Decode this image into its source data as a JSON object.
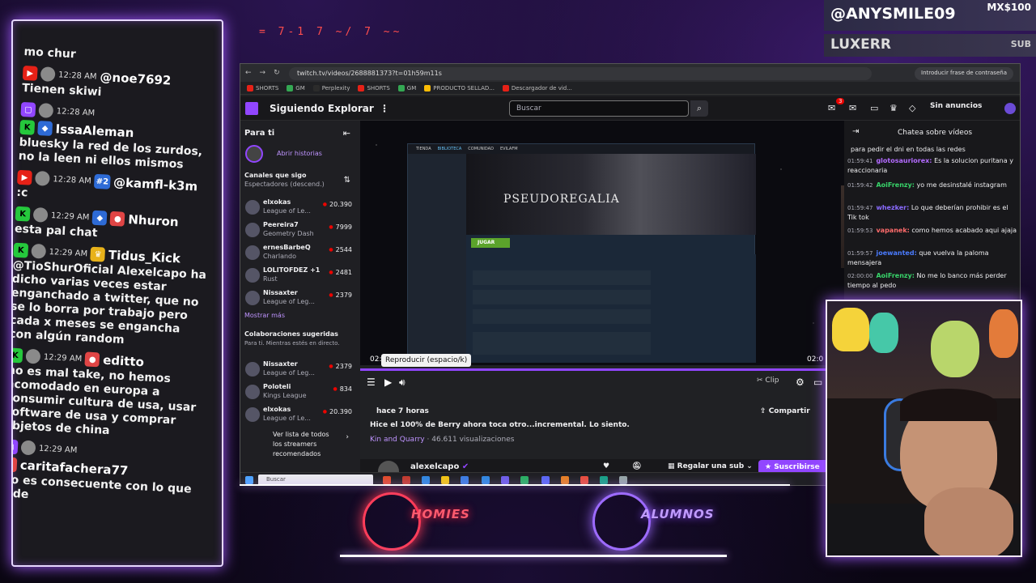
{
  "overlay": {
    "handwriting": "= 7-1 7 ~/ 7 ~~",
    "alert_top": {
      "name": "@ANYSMILE09",
      "amount": "MX$100"
    },
    "alert_sub": {
      "name": "LUXERR",
      "tag": "SUB"
    },
    "logos": [
      {
        "name": "HOMIES",
        "color": "#ff3d5a"
      },
      {
        "name": "ALUMNOS",
        "color": "#9d6bff"
      }
    ]
  },
  "stream_chat": {
    "messages": [
      {
        "platform": "youtube",
        "time": "",
        "user": "",
        "text": "mo chur"
      },
      {
        "platform": "youtube",
        "time": "12:28 AM",
        "user": "@noe7692",
        "text": "Tienen skiwi"
      },
      {
        "platform": "twitch",
        "time": "12:28 AM",
        "user": "",
        "text": ""
      },
      {
        "platform": "kick",
        "time": "",
        "user": "IssaAleman",
        "text": "bluesky la red de los zurdos, no la leen ni ellos mismos"
      },
      {
        "platform": "youtube",
        "time": "12:28 AM",
        "user": "@kamfl-k3m",
        "badge": "#2",
        "text": ":c"
      },
      {
        "platform": "kick",
        "time": "12:29 AM",
        "user": "Nhuron",
        "text": "esta pal chat"
      },
      {
        "platform": "kick",
        "time": "12:29 AM",
        "user": "Tidus_Kick",
        "text": "@TioShurOficial Alexelcapo ha dicho varias veces estar enganchado a twitter, que no se lo borra por trabajo pero cada x meses se engancha con algún random"
      },
      {
        "platform": "kick",
        "time": "12:29 AM",
        "user": "editto",
        "text": "no es mal take, no hemos acomodado en europa a consumir cultura de usa, usar software de usa y comprar objetos de china"
      },
      {
        "platform": "twitch",
        "time": "12:29 AM",
        "user": "caritafachera77",
        "text": "No es consecuente con lo que pide"
      }
    ]
  },
  "browser": {
    "url": "twitch.tv/videos/2688881373?t=01h59m11s",
    "password_chip": "Introducir frase de contraseña",
    "bookmarks": [
      "SHORTS",
      "GM",
      "Perplexity",
      "SHORTS",
      "GM",
      "PRODUCTO SELLAD...",
      "Descargador de vid..."
    ],
    "nav": {
      "following": "Siguiendo",
      "browse": "Explorar",
      "more": "⋮",
      "search_placeholder": "Buscar",
      "notif_count": "3",
      "ads": "Sin anuncios"
    },
    "sidebar": {
      "title": "Para ti",
      "stories": "Abrir historias",
      "followed_title": "Canales que sigo",
      "followed_sort": "Espectadores (descend.)",
      "followed": [
        {
          "name": "elxokas",
          "game": "League of Le...",
          "viewers": "20.390"
        },
        {
          "name": "Peereira7",
          "game": "Geometry Dash",
          "viewers": "7999"
        },
        {
          "name": "ernesBarbeQ",
          "game": "Charlando",
          "viewers": "2544"
        },
        {
          "name": "LOLITOFDEZ +1",
          "game": "Rust",
          "viewers": "2481"
        },
        {
          "name": "Nissaxter",
          "game": "League of Leg...",
          "viewers": "2379"
        }
      ],
      "show_more": "Mostrar más",
      "collab_title": "Colaboraciones sugeridas",
      "collab_sub": "Para ti. Mientras estés en directo.",
      "collab": [
        {
          "name": "Nissaxter",
          "game": "League of Leg...",
          "viewers": "2379"
        },
        {
          "name": "Poloteli",
          "game": "Kings League",
          "viewers": "834"
        },
        {
          "name": "elxokas",
          "game": "League of Le...",
          "viewers": "20.390"
        }
      ],
      "see_all": "Ver lista de todos los streamers recomendados"
    },
    "player": {
      "steam_title": "PSEUDOREGALIA",
      "steam_play": "JUGAR",
      "steam_tabs": [
        "TIENDA",
        "BIBLIOTECA",
        "COMUNIDAD",
        "EVILAFM"
      ],
      "tooltip": "Reproducir (espacio/k)",
      "time_left": "02:",
      "time_right": "02:0",
      "progress": 0.97,
      "clip": "Clip"
    },
    "info": {
      "when": "hace 7 horas",
      "title": "Hice el 100% de Berry ahora toca otro...incremental. Lo siento.",
      "game": "Kin and Quarry",
      "views": "· 46.611 visualizaciones",
      "share": "Compartir"
    },
    "streamer": {
      "name": "alexelcapo",
      "gift": "Regalar una sub",
      "subscribe": "Suscribirse"
    },
    "vod_chat": {
      "title": "Chatea sobre vídeos",
      "messages": [
        {
          "time": "",
          "user": "",
          "user_color": "#efeff1",
          "text": "para pedir el dni en todas las redes"
        },
        {
          "time": "01:59:41",
          "user": "glotosauriorex:",
          "user_color": "#b36bff",
          "text": "Es la solucion puritana y reaccionaria"
        },
        {
          "time": "01:59:42",
          "user": "AoiFrenzy:",
          "user_color": "#38d46a",
          "text": "yo me desinstalé instagram"
        },
        {
          "time": "01:59:47",
          "user": "whezker:",
          "user_color": "#8a6bff",
          "text": "Lo que deberían prohibir es el Tik tok"
        },
        {
          "time": "01:59:53",
          "user": "vapanek:",
          "user_color": "#ff6b6b",
          "text": "como hemos acabado aqui ajaja"
        },
        {
          "time": "01:59:57",
          "user": "joewanted:",
          "user_color": "#4a7bff",
          "text": "que vuelva la paloma mensajera"
        },
        {
          "time": "02:00:00",
          "user": "AoiFrenzy:",
          "user_color": "#38d46a",
          "text": "No me lo banco más perder tiempo al pedo"
        }
      ]
    },
    "taskbar": {
      "search": "Buscar"
    }
  }
}
